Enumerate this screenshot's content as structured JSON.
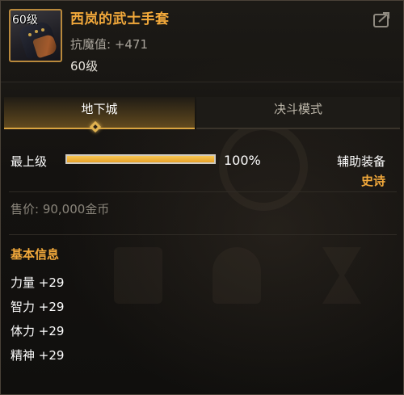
{
  "item": {
    "icon_level": "60级",
    "name": "西岚的武士手套",
    "stat": "抗魔值: +471",
    "level": "60级",
    "icon": "glove-icon",
    "name_color": "#f2a93b"
  },
  "header": {
    "share_icon": "share-icon"
  },
  "tabs": [
    {
      "label": "地下城",
      "active": true
    },
    {
      "label": "决斗模式",
      "active": false
    }
  ],
  "proficiency": {
    "label": "最上级",
    "percent_text": "100%",
    "fill_fraction": 1.0
  },
  "item_type": "辅助装备",
  "rarity": "史诗",
  "price": "售价: 90,000金币",
  "basic_info": {
    "title": "基本信息",
    "attributes": [
      "力量 +29",
      "智力 +29",
      "体力 +29",
      "精神 +29"
    ]
  },
  "colors": {
    "accent": "#f2a93b",
    "bar_fill": "#e7a22a"
  }
}
